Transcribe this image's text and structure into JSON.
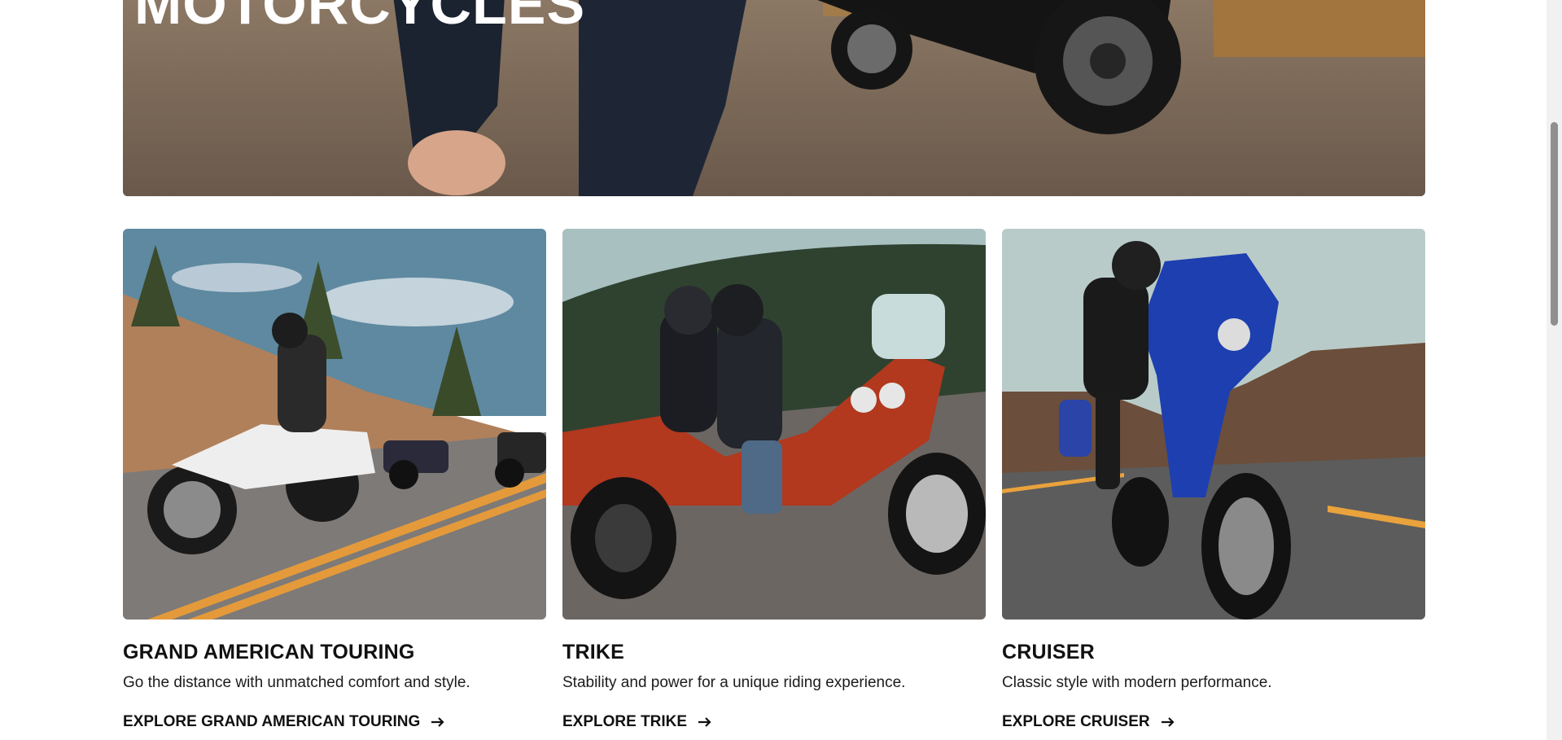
{
  "hero": {
    "title": "MOTORCYCLES"
  },
  "cards": [
    {
      "title": "GRAND AMERICAN TOURING",
      "description": "Go the distance with unmatched comfort and style.",
      "link_label": "EXPLORE GRAND AMERICAN TOURING",
      "icon": "arrow-right-icon"
    },
    {
      "title": "TRIKE",
      "description": "Stability and power for a unique riding experience.",
      "link_label": "EXPLORE TRIKE",
      "icon": "arrow-right-icon"
    },
    {
      "title": "CRUISER",
      "description": "Classic style with modern performance.",
      "link_label": "EXPLORE CRUISER",
      "icon": "arrow-right-icon"
    }
  ],
  "colors": {
    "text": "#111111",
    "background": "#ffffff",
    "scrollbar_track": "#f1f1f1",
    "scrollbar_thumb": "#8f8f8f"
  }
}
